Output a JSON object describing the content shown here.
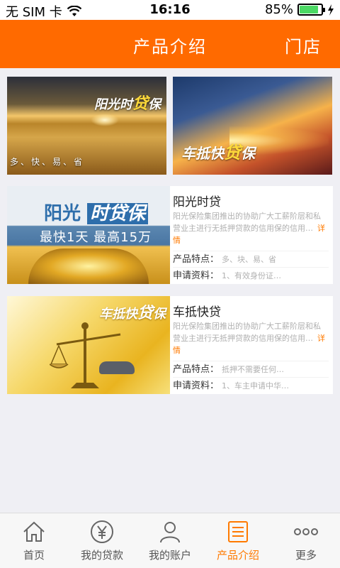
{
  "status_bar": {
    "carrier": "无 SIM 卡",
    "time": "16:16",
    "battery": "85%",
    "battery_level": 0.85,
    "wifi_icon": "wifi-icon",
    "charging_icon": "charging-icon"
  },
  "header": {
    "title": "产品介绍",
    "right_action": "门店"
  },
  "banners": [
    {
      "tag_prefix": "阳光",
      "tag_mid": "时",
      "tag_big": "贷",
      "tag_suffix": "保",
      "subtitle": "多、快、易、省"
    },
    {
      "tag_prefix": "车抵快",
      "tag_big": "贷",
      "tag_suffix": "保"
    }
  ],
  "products": [
    {
      "image_title_a": "阳光",
      "image_title_b": "时贷保",
      "image_subtitle": "最快1天  最高15万",
      "name": "阳光时贷",
      "desc": "阳光保险集团推出的协助广大工薪阶层和私营业主进行无抵押贷款的信用保的信用…",
      "more": "详情",
      "feature_label": "产品特点：",
      "feature_value": "多、块、易、省",
      "docs_label": "申请资料：",
      "docs_value": "1、有效身份证…"
    },
    {
      "image_tag_prefix": "车抵快",
      "image_tag_big": "贷",
      "image_tag_suffix": "保",
      "name": "车抵快贷",
      "desc": "阳光保险集团推出的协助广大工薪阶层和私营业主进行无抵押贷款的信用保的信用…",
      "more": "详情",
      "feature_label": "产品特点：",
      "feature_value": "抵押不需要任何…",
      "docs_label": "申请资料：",
      "docs_value": "1、车主申请中华…"
    }
  ],
  "tabbar": {
    "active_color": "#ff7a00",
    "items": [
      {
        "label": "首页",
        "icon": "home-icon"
      },
      {
        "label": "我的贷款",
        "icon": "yen-coin-icon"
      },
      {
        "label": "我的账户",
        "icon": "user-icon"
      },
      {
        "label": "产品介绍",
        "icon": "list-icon"
      },
      {
        "label": "更多",
        "icon": "more-icon"
      }
    ]
  },
  "colors": {
    "header_bg": "#ff6a00",
    "accent": "#ff7a00",
    "battery_fill": "#4cd964"
  }
}
